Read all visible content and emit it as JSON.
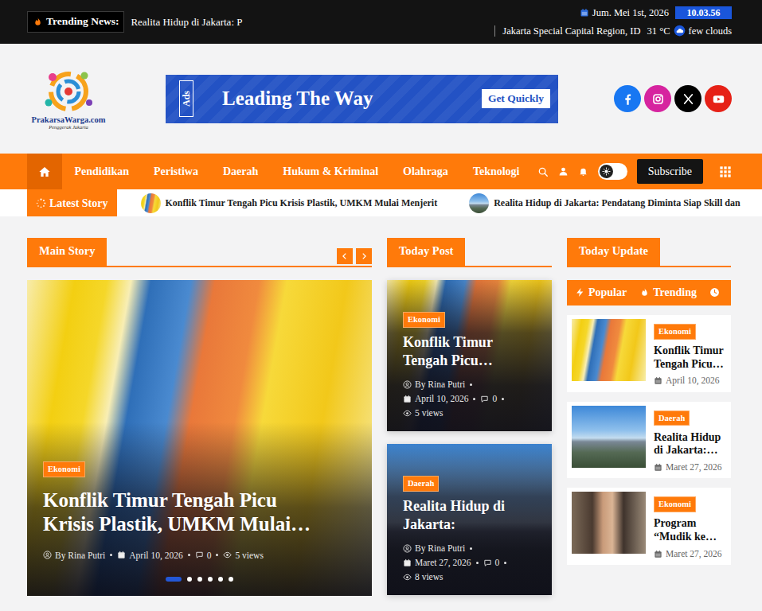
{
  "topbar": {
    "trending_label": "Trending News:",
    "trending_text": "Realita Hidup di Jakarta: P",
    "date": "Jum. Mei 1st, 2026",
    "time": "10.03.56",
    "location": "Jakarta Special Capital Region, ID",
    "temperature": "31 °C",
    "weather": "few clouds"
  },
  "header": {
    "logo_text": "PrakarsaWarga.com",
    "logo_tagline": "Penggerak Jakarta",
    "ad": {
      "tag": "Ads",
      "headline": "Leading The Way",
      "button": "Get Quickly"
    },
    "socials": [
      {
        "kind": "facebook",
        "color": "#1877f2"
      },
      {
        "kind": "instagram",
        "color": "#d6249f"
      },
      {
        "kind": "x",
        "color": "#000000"
      },
      {
        "kind": "youtube",
        "color": "#e62117"
      }
    ]
  },
  "nav": {
    "home": {
      "selected": true
    },
    "items": [
      {
        "label": "Pendidikan",
        "selected": false
      },
      {
        "label": "Peristiwa",
        "selected": false
      },
      {
        "label": "Daerah",
        "selected": false
      },
      {
        "label": "Hukum & Kriminal",
        "selected": false
      },
      {
        "label": "Olahraga",
        "selected": false
      },
      {
        "label": "Teknologi",
        "selected": false
      }
    ],
    "dark_mode": false,
    "subscribe": "Subscribe"
  },
  "latest": {
    "label": "Latest Story",
    "items": [
      {
        "title": "Konflik Timur Tengah Picu Krisis Plastik, UMKM Mulai Menjerit",
        "kind": "plastic"
      },
      {
        "title": "Realita Hidup di Jakarta: Pendatang Diminta Siap Skill dan",
        "kind": "city"
      }
    ]
  },
  "main_story": {
    "heading": "Main Story",
    "post": {
      "category": "Ekonomi",
      "title": "Konflik Timur Tengah Picu Krisis Plastik, UMKM Mulai…",
      "author": "By Rina Putri",
      "date": "April 10, 2026",
      "comments": "0",
      "views": "5 views",
      "kind": "plastic"
    },
    "dots": [
      {
        "selected": true
      },
      {
        "selected": false
      },
      {
        "selected": false
      },
      {
        "selected": false
      },
      {
        "selected": false
      },
      {
        "selected": false
      }
    ]
  },
  "today_post": {
    "heading": "Today Post",
    "posts": [
      {
        "category": "Ekonomi",
        "title": "Konflik Timur Tengah Picu…",
        "author": "By Rina Putri",
        "date": "April 10, 2026",
        "comments": "0",
        "views": "5 views",
        "kind": "plastic"
      },
      {
        "category": "Daerah",
        "title": "Realita Hidup di Jakarta:",
        "author": "By Rina Putri",
        "date": "Maret 27, 2026",
        "comments": "0",
        "views": "8 views",
        "kind": "city"
      }
    ]
  },
  "today_update": {
    "heading": "Today Update",
    "tabs": [
      {
        "label": "Popular",
        "kind": "bolt"
      },
      {
        "label": "Trending",
        "kind": "fire"
      },
      {
        "kind": "clock"
      }
    ],
    "items": [
      {
        "category": "Ekonomi",
        "title": "Konflik Timur Tengah Picu…",
        "date": "April 10, 2026",
        "kind": "plastic"
      },
      {
        "category": "Daerah",
        "title": "Realita Hidup di Jakarta:…",
        "date": "Maret 27, 2026",
        "kind": "city"
      },
      {
        "category": "Ekonomi",
        "title": "Program “Mudik ke…",
        "date": "Maret 27, 2026",
        "kind": "portrait"
      }
    ]
  }
}
